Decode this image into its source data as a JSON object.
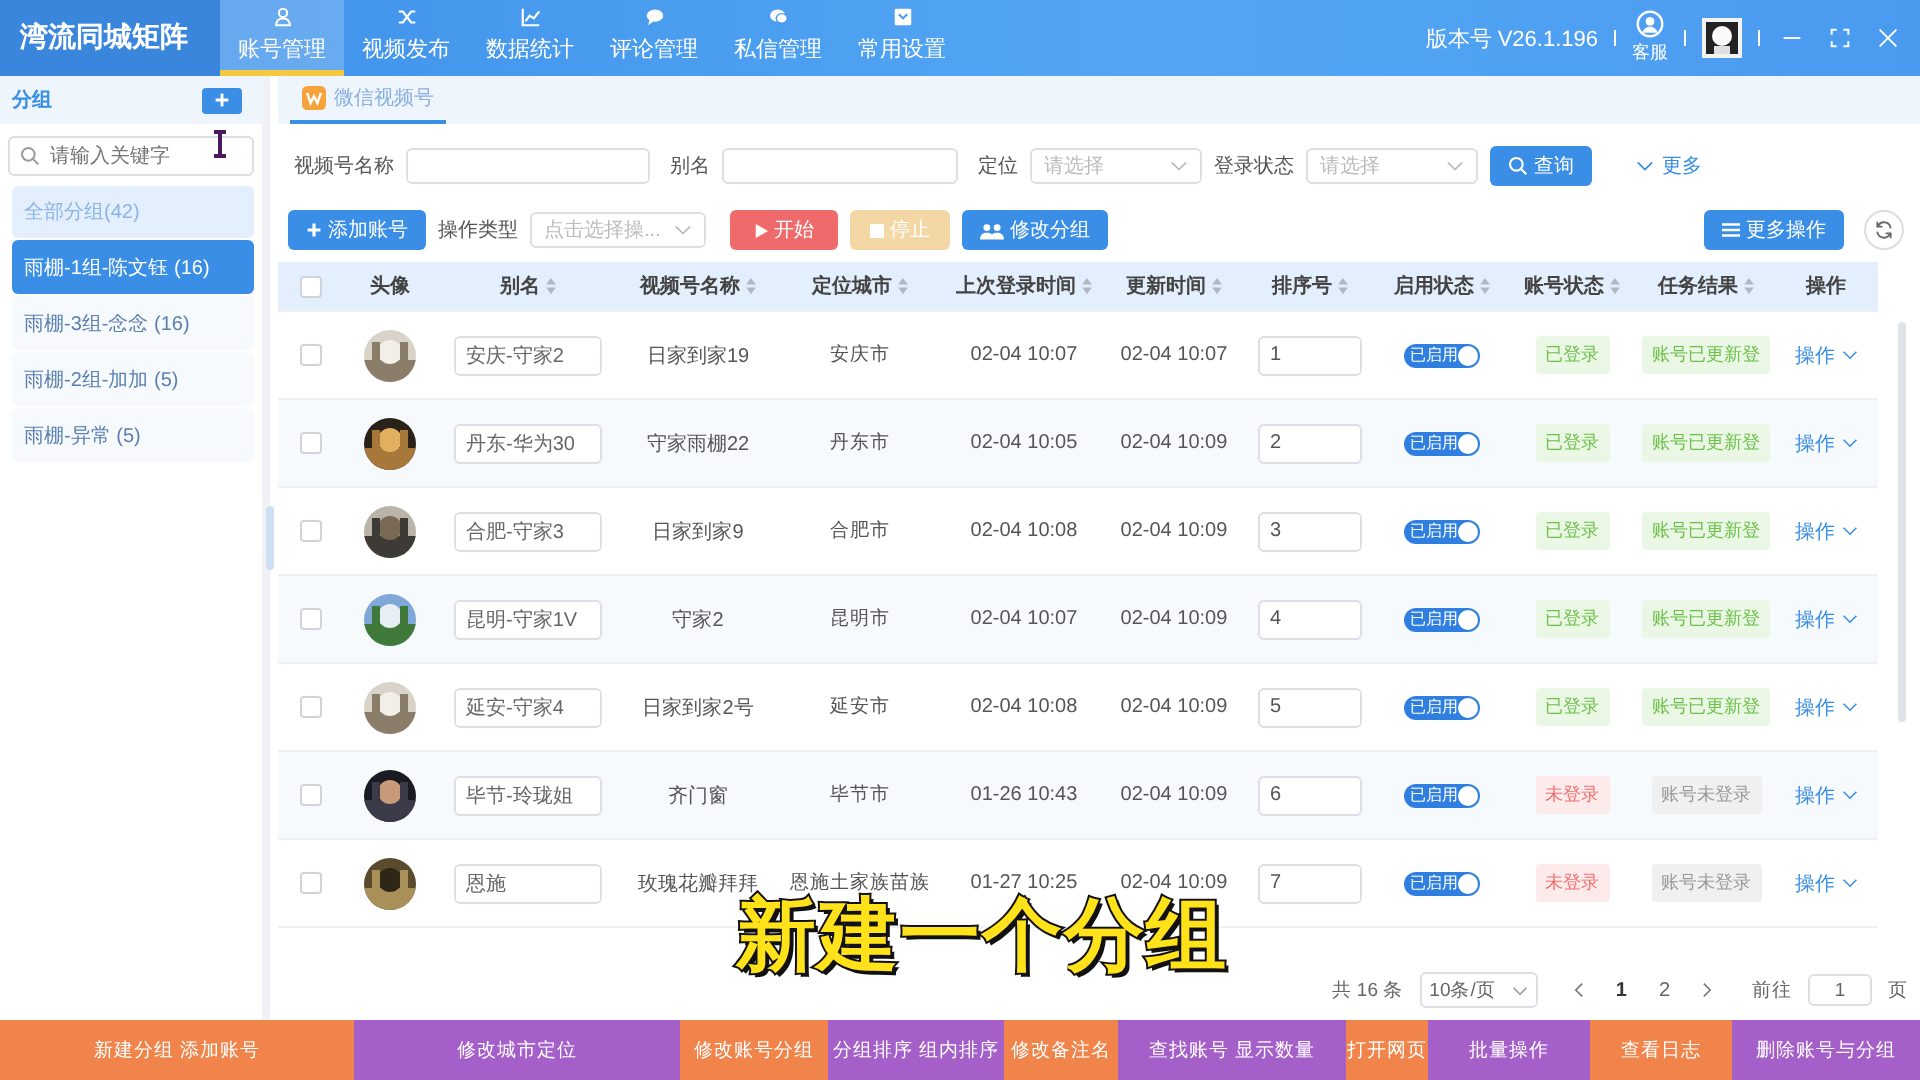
{
  "app": {
    "title": "湾流同城矩阵",
    "version": "版本号 V26.1.196",
    "support": "客服"
  },
  "nav": [
    {
      "label": "账号管理",
      "selected": true
    },
    {
      "label": "视频发布",
      "selected": false
    },
    {
      "label": "数据统计",
      "selected": false
    },
    {
      "label": "评论管理",
      "selected": false
    },
    {
      "label": "私信管理",
      "selected": false
    },
    {
      "label": "常用设置",
      "selected": false
    }
  ],
  "sidebar": {
    "title": "分组",
    "search_placeholder": "请输入关键字",
    "items": [
      {
        "label": "全部分组(42)",
        "kind": "all",
        "selected": false
      },
      {
        "label": "雨棚-1组-陈文钰 (16)",
        "kind": "group",
        "selected": true
      },
      {
        "label": "雨棚-3组-念念 (16)",
        "kind": "group",
        "selected": false
      },
      {
        "label": "雨棚-2组-加加 (5)",
        "kind": "group",
        "selected": false
      },
      {
        "label": "雨棚-异常 (5)",
        "kind": "group",
        "selected": false
      }
    ]
  },
  "tabs": [
    {
      "label": "微信视频号",
      "selected": true
    }
  ],
  "filters": [
    {
      "label": "视频号名称",
      "kind": "input"
    },
    {
      "label": "别名",
      "kind": "input"
    },
    {
      "label": "定位",
      "kind": "select",
      "placeholder": "请选择"
    },
    {
      "label": "登录状态",
      "kind": "select",
      "placeholder": "请选择"
    }
  ],
  "query_button": "查询",
  "more_link": "更多",
  "actions": {
    "add": "添加账号",
    "op_type_label": "操作类型",
    "op_type_placeholder": "点击选择操...",
    "start": "开始",
    "stop": "停止",
    "stop_disabled": true,
    "change_group": "修改分组",
    "more_ops": "更多操作"
  },
  "table": {
    "select_all_checked": false,
    "columns": [
      "头像",
      "别名",
      "视频号名称",
      "定位城市",
      "上次登录时间",
      "更新时间",
      "排序号",
      "启用状态",
      "账号状态",
      "任务结果",
      "操作"
    ],
    "rows": [
      {
        "checked": false,
        "alias": "安庆-守家2",
        "name": "日家到家19",
        "city": "安庆市",
        "last_login": "02-04 10:07",
        "updated": "02-04 10:07",
        "order": "1",
        "enabled": true,
        "enabled_label": "已启用",
        "status": {
          "text": "已登录",
          "kind": "ok"
        },
        "result": {
          "text": "账号已更新登",
          "kind": "ok"
        },
        "op": "操作"
      },
      {
        "checked": false,
        "alias": "丹东-华为30",
        "name": "守家雨棚22",
        "city": "丹东市",
        "last_login": "02-04 10:05",
        "updated": "02-04 10:09",
        "order": "2",
        "enabled": true,
        "enabled_label": "已启用",
        "status": {
          "text": "已登录",
          "kind": "ok"
        },
        "result": {
          "text": "账号已更新登",
          "kind": "ok"
        },
        "op": "操作"
      },
      {
        "checked": false,
        "alias": "合肥-守家3",
        "name": "日家到家9",
        "city": "合肥市",
        "last_login": "02-04 10:08",
        "updated": "02-04 10:09",
        "order": "3",
        "enabled": true,
        "enabled_label": "已启用",
        "status": {
          "text": "已登录",
          "kind": "ok"
        },
        "result": {
          "text": "账号已更新登",
          "kind": "ok"
        },
        "op": "操作"
      },
      {
        "checked": false,
        "alias": "昆明-守家1V",
        "name": "守家2",
        "city": "昆明市",
        "last_login": "02-04 10:07",
        "updated": "02-04 10:09",
        "order": "4",
        "enabled": true,
        "enabled_label": "已启用",
        "status": {
          "text": "已登录",
          "kind": "ok"
        },
        "result": {
          "text": "账号已更新登",
          "kind": "ok"
        },
        "op": "操作"
      },
      {
        "checked": false,
        "alias": "延安-守家4",
        "name": "日家到家2号",
        "city": "延安市",
        "last_login": "02-04 10:08",
        "updated": "02-04 10:09",
        "order": "5",
        "enabled": true,
        "enabled_label": "已启用",
        "status": {
          "text": "已登录",
          "kind": "ok"
        },
        "result": {
          "text": "账号已更新登",
          "kind": "ok"
        },
        "op": "操作"
      },
      {
        "checked": false,
        "alias": "毕节-玲珑姐",
        "name": "齐门窗",
        "city": "毕节市",
        "last_login": "01-26 10:43",
        "updated": "02-04 10:09",
        "order": "6",
        "enabled": true,
        "enabled_label": "已启用",
        "status": {
          "text": "未登录",
          "kind": "bad"
        },
        "result": {
          "text": "账号未登录",
          "kind": "none"
        },
        "op": "操作"
      },
      {
        "checked": false,
        "alias": "恩施",
        "name": "玫瑰花瓣拜拜",
        "city": "恩施土家族苗族",
        "last_login": "01-27 10:25",
        "updated": "02-04 10:09",
        "order": "7",
        "enabled": true,
        "enabled_label": "已启用",
        "status": {
          "text": "未登录",
          "kind": "bad"
        },
        "result": {
          "text": "账号未登录",
          "kind": "none"
        },
        "op": "操作"
      }
    ]
  },
  "pagination": {
    "total": "共 16 条",
    "page_size": "10条/页",
    "pages": [
      {
        "label": "1",
        "selected": true
      },
      {
        "label": "2",
        "selected": false
      }
    ],
    "goto_label": "前往",
    "goto_value": "1",
    "goto_suffix": "页"
  },
  "caption": "新建一个分组",
  "bottom_bar": [
    {
      "label": "新建分组 添加账号",
      "color": "#f0844a"
    },
    {
      "label": "修改城市定位",
      "color": "#a55fc9"
    },
    {
      "label": "修改账号分组",
      "color": "#f0844a"
    },
    {
      "label": "分组排序 组内排序",
      "color": "#a55fc9"
    },
    {
      "label": "修改备注名",
      "color": "#f0844a"
    },
    {
      "label": "查找账号 显示数量",
      "color": "#a55fc9"
    },
    {
      "label": "打开网页",
      "color": "#f0844a"
    },
    {
      "label": "批量操作",
      "color": "#a55fc9"
    },
    {
      "label": "查看日志",
      "color": "#f0844a"
    },
    {
      "label": "删除账号与分组",
      "color": "#a55fc9"
    }
  ]
}
